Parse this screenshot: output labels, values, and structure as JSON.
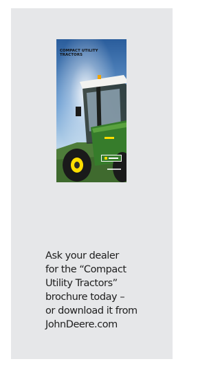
{
  "brochure": {
    "title": "COMPACT UTILITY\nTRACTORS",
    "brand_colors": {
      "green": "#367c2b",
      "yellow": "#ffde00"
    },
    "logo_icon": "john-deere-logo-icon"
  },
  "caption": {
    "text": "Ask your dealer\nfor the “Compact\nUtility Tractors”\nbrochure today –\nor download it from\nJohnDeere.com"
  }
}
